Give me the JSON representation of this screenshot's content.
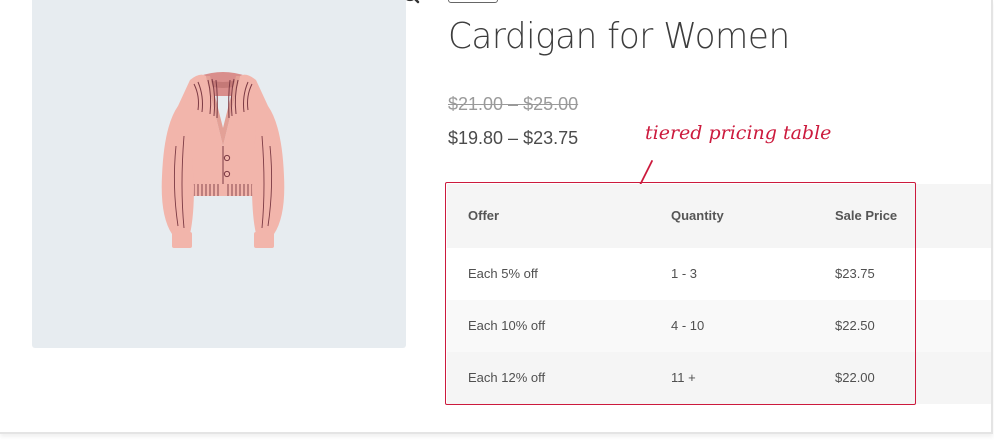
{
  "product": {
    "title": "Cardigan for Women",
    "price_regular": "$21.00 – $25.00",
    "price_sale": "$19.80 – $23.75",
    "image_icon": "cardigan-image",
    "zoom_icon": "magnifier-zoom-icon"
  },
  "annotation": {
    "text": "tiered pricing table",
    "color": "#cc1a3d"
  },
  "pricing_table": {
    "headers": [
      "Offer",
      "Quantity",
      "Sale Price"
    ],
    "rows": [
      [
        "Each 5% off",
        "1 - 3",
        "$23.75"
      ],
      [
        "Each 10% off",
        "4 - 10",
        "$22.50"
      ],
      [
        "Each 12% off",
        "11 +",
        "$22.00"
      ]
    ]
  }
}
